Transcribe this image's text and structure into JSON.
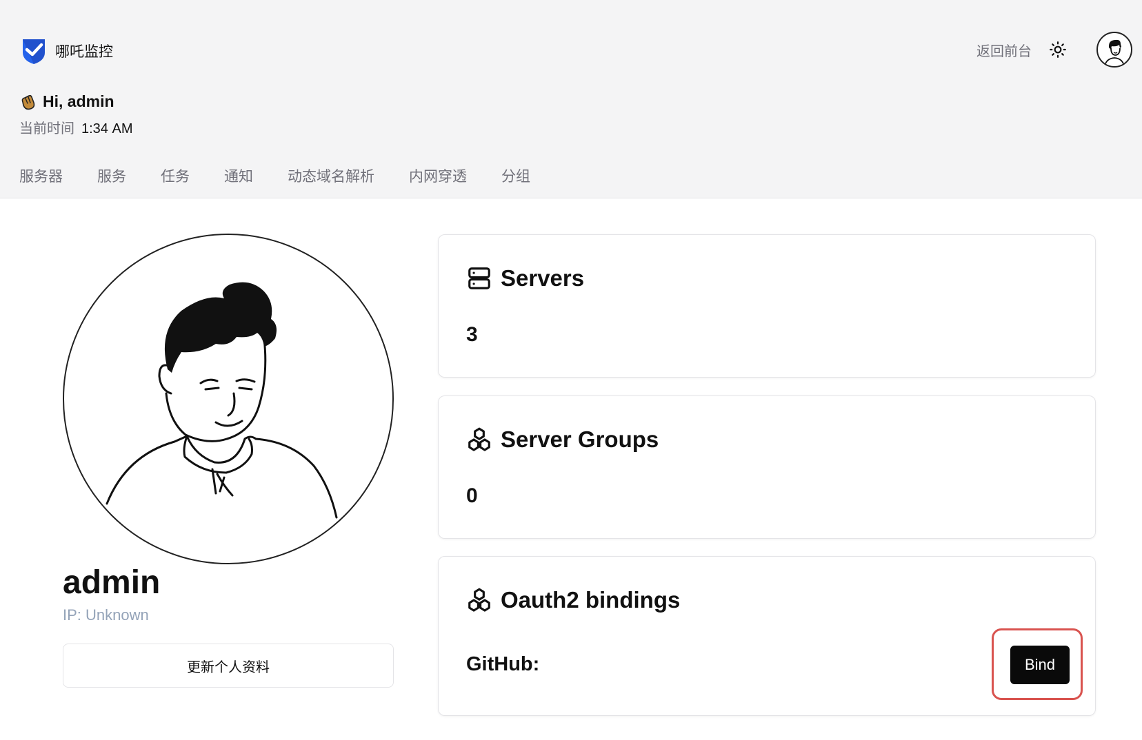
{
  "header": {
    "brand": "哪吒监控",
    "back_link": "返回前台",
    "greeting": "Hi, admin",
    "time_label": "当前时间",
    "time_value": "1:34 AM"
  },
  "nav": {
    "items": [
      "服务器",
      "服务",
      "任务",
      "通知",
      "动态域名解析",
      "内网穿透",
      "分组"
    ]
  },
  "profile": {
    "name": "admin",
    "ip": "IP: Unknown",
    "update_button": "更新个人资料"
  },
  "cards": {
    "servers": {
      "title": "Servers",
      "value": "3"
    },
    "server_groups": {
      "title": "Server Groups",
      "value": "0"
    },
    "oauth": {
      "title": "Oauth2 bindings",
      "provider": "GitHub:",
      "bind_button": "Bind"
    }
  },
  "colors": {
    "header_bg": "#f4f4f5",
    "brand_blue": "#2563eb",
    "muted_text": "#71717a",
    "ip_text": "#94a3b8",
    "bind_bg": "#0a0a0a",
    "highlight": "#d9534f"
  },
  "icons": {
    "brand": "shield-check-icon",
    "theme": "sun-icon",
    "greeting": "waving-hand-icon",
    "servers": "server-icon",
    "groups": "boxes-icon",
    "oauth": "boxes-icon"
  }
}
